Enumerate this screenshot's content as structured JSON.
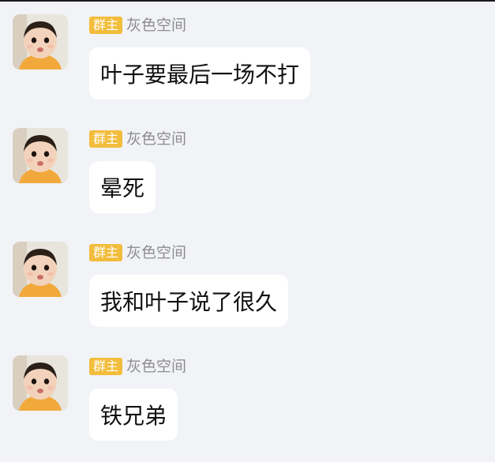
{
  "colors": {
    "background": "#f2f3f7",
    "bubble": "#ffffff",
    "badge": "#f2bd3c",
    "nickname": "#8c8c8c",
    "text": "#111111"
  },
  "messages": [
    {
      "badge": "群主",
      "sender": "灰色空间",
      "text": "叶子要最后一场不打",
      "avatar_icon": "baby-avatar"
    },
    {
      "badge": "群主",
      "sender": "灰色空间",
      "text": "晕死",
      "avatar_icon": "baby-avatar"
    },
    {
      "badge": "群主",
      "sender": "灰色空间",
      "text": "我和叶子说了很久",
      "avatar_icon": "baby-avatar"
    },
    {
      "badge": "群主",
      "sender": "灰色空间",
      "text": "铁兄弟",
      "avatar_icon": "baby-avatar"
    }
  ]
}
